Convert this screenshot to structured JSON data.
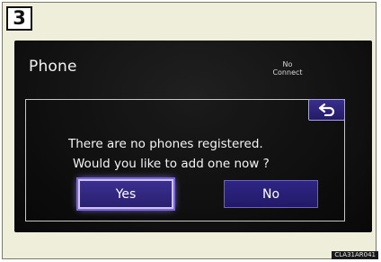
{
  "step": {
    "number": "3"
  },
  "screen": {
    "title": "Phone",
    "status": {
      "line1": "No",
      "line2": "Connect"
    }
  },
  "dialog": {
    "message_line1": "There are no phones registered.",
    "message_line2": "Would you like to add one now ?",
    "back_icon": "back-arrow-icon",
    "yes_label": "Yes",
    "no_label": "No",
    "selected": "Yes"
  },
  "figure": {
    "code": "CLA31AR041"
  },
  "colors": {
    "frame_background": "#efeeda",
    "screen_background": "#121212",
    "button_fill": "#2e2585",
    "button_focus_outline": "#cfc4ff"
  }
}
